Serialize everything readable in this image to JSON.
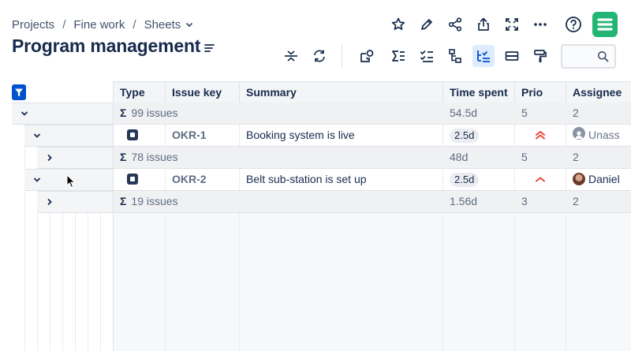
{
  "breadcrumb": {
    "items": [
      "Projects",
      "Fine work",
      "Sheets"
    ],
    "separator": "/"
  },
  "page": {
    "title": "Program management"
  },
  "toolbar_top": [
    "star-icon",
    "edit-icon",
    "share-icon",
    "export-icon",
    "fullscreen-icon",
    "more-icon",
    "help-icon"
  ],
  "toolbar_main": [
    "collapse-rows-icon",
    "refresh-icon",
    "structure-icon",
    "sum-icon",
    "checklist-icon",
    "hierarchy-icon",
    "tree-view-icon",
    "grouping-icon",
    "format-painter-icon"
  ],
  "search": {
    "placeholder": "",
    "value": ""
  },
  "colors": {
    "accent": "#0052cc",
    "logo": "#22b573",
    "priority": "#e5493a"
  },
  "table": {
    "columns": [
      "Type",
      "Issue key",
      "Summary",
      "Time spent",
      "Prio",
      "Assignee"
    ],
    "rows": [
      {
        "kind": "group",
        "summary": "99 issues",
        "time_spent": "54.5d",
        "prio": "5",
        "assignee": "2"
      },
      {
        "kind": "item",
        "type": "task",
        "key": "OKR-1",
        "summary": "Booking system is live",
        "time_spent": "2.5d",
        "prio": "highest",
        "assignee": "Unassigned"
      },
      {
        "kind": "group",
        "summary": "78 issues",
        "time_spent": "48d",
        "prio": "5",
        "assignee": "2"
      },
      {
        "kind": "item",
        "type": "task",
        "key": "OKR-2",
        "summary": "Belt sub-station is set up",
        "time_spent": "2.5d",
        "prio": "high",
        "assignee": "Daniel"
      },
      {
        "kind": "group",
        "summary": "19 issues",
        "time_spent": "1.56d",
        "prio": "3",
        "assignee": "2"
      }
    ]
  }
}
